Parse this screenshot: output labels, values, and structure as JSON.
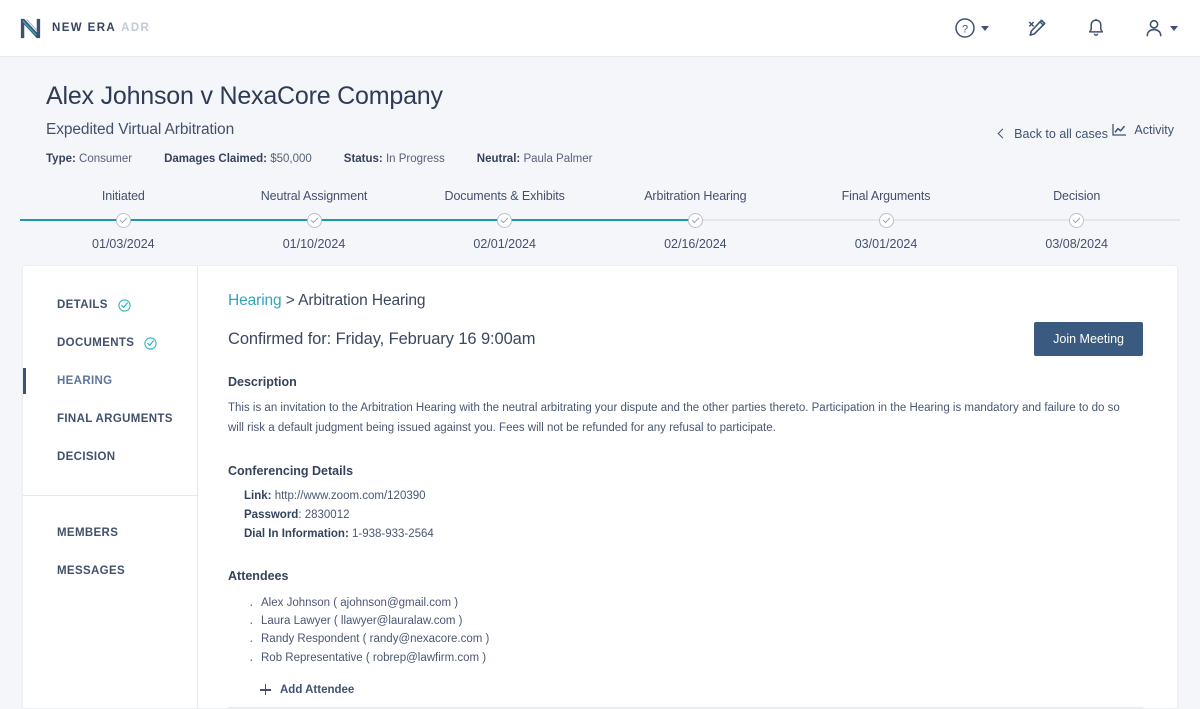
{
  "topbar": {
    "logo_main": "NEW ERA",
    "logo_sub": "ADR",
    "items": [
      {
        "icon": "help-circle-icon",
        "has_caret": true
      },
      {
        "icon": "signature-pen-icon",
        "has_caret": false
      },
      {
        "icon": "bell-notification-icon",
        "has_caret": false
      },
      {
        "icon": "user-account-icon",
        "has_caret": true
      }
    ]
  },
  "case": {
    "title": "Alex Johnson v NexaCore Company",
    "subtitle": "Expedited Virtual Arbitration",
    "meta": [
      {
        "label": "Type:",
        "value": "Consumer"
      },
      {
        "label": "Damages Claimed:",
        "value": "$50,000"
      },
      {
        "label": "Status:",
        "value": "In Progress"
      },
      {
        "label": "Neutral:",
        "value": "Paula Palmer"
      }
    ],
    "back_link": "Back to all cases",
    "activity_link": "Activity"
  },
  "stepper": {
    "steps": [
      {
        "label": "Initiated",
        "date": "01/03/2024",
        "state": "done"
      },
      {
        "label": "Neutral Assignment",
        "date": "01/10/2024",
        "state": "done"
      },
      {
        "label": "Documents & Exhibits",
        "date": "02/01/2024",
        "state": "done"
      },
      {
        "label": "Arbitration Hearing",
        "date": "02/16/2024",
        "state": "current"
      },
      {
        "label": "Final Arguments",
        "date": "03/01/2024",
        "state": "upcoming"
      },
      {
        "label": "Decision",
        "date": "03/08/2024",
        "state": "upcoming"
      }
    ]
  },
  "sidebar": {
    "items": [
      {
        "label": "DETAILS",
        "complete": true,
        "active": false
      },
      {
        "label": "DOCUMENTS",
        "complete": true,
        "active": false
      },
      {
        "label": "HEARING",
        "complete": false,
        "active": true
      },
      {
        "label": "FINAL ARGUMENTS",
        "complete": false,
        "active": false
      },
      {
        "label": "DECISION",
        "complete": false,
        "active": false
      }
    ],
    "secondary": [
      {
        "label": "MEMBERS"
      },
      {
        "label": "MESSAGES"
      }
    ]
  },
  "main": {
    "breadcrumb_parent": "Hearing",
    "breadcrumb_sep": " > ",
    "breadcrumb_current": "Arbitration Hearing",
    "confirmed": "Confirmed for: Friday, February 16 9:00am",
    "join_button": "Join Meeting",
    "description_heading": "Description",
    "description": "This is an invitation to the Arbitration Hearing with the neutral arbitrating your dispute and the other parties thereto. Participation in the Hearing is mandatory and failure to do so will risk a default judgment being issued against you. Fees will not be refunded for any refusal to participate.",
    "conferencing_heading": "Conferencing Details",
    "conferencing": [
      {
        "label": "Link:",
        "value": "http://www.zoom.com/120390"
      },
      {
        "label": "Password",
        "value": ": 2830012"
      },
      {
        "label": "Dial In Information:",
        "value": "1-938-933-2564"
      }
    ],
    "attendees_heading": "Attendees",
    "attendees": [
      "Alex Johnson ( ajohnson@gmail.com )",
      "Laura Lawyer ( llawyer@lauralaw.com )",
      "Randy Respondent ( randy@nexacore.com )",
      "Rob Representative ( robrep@lawfirm.com )"
    ],
    "add_attendee": "Add Attendee"
  },
  "colors": {
    "teal": "#1a9aa8",
    "navy": "#3b5a7f",
    "link_teal": "#34a5b5",
    "page_bg": "#f5f6fa"
  }
}
